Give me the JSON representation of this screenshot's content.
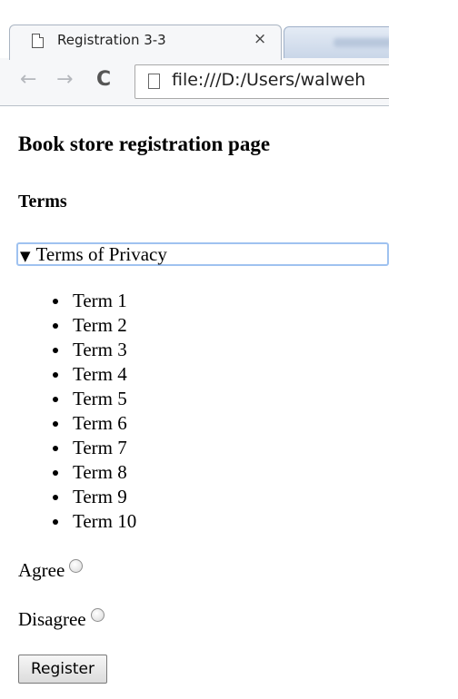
{
  "browser": {
    "tab_title": "Registration 3-3",
    "close_glyph": "×",
    "back_glyph": "←",
    "forward_glyph": "→",
    "reload_glyph": "C",
    "address": "file:///D:/Users/walweh"
  },
  "page": {
    "heading": "Book store registration page",
    "subheading": "Terms",
    "details_summary": "Terms of Privacy",
    "details_open_glyph": "▼",
    "terms": [
      "Term 1",
      "Term 2",
      "Term 3",
      "Term 4",
      "Term 5",
      "Term 6",
      "Term 7",
      "Term 8",
      "Term 9",
      "Term 10"
    ],
    "agree_label": "Agree",
    "disagree_label": "Disagree",
    "register_label": "Register"
  },
  "colors": {
    "summary_focus_outline": "#9fc2f0",
    "toolbar_bg": "#f6f7f9"
  }
}
